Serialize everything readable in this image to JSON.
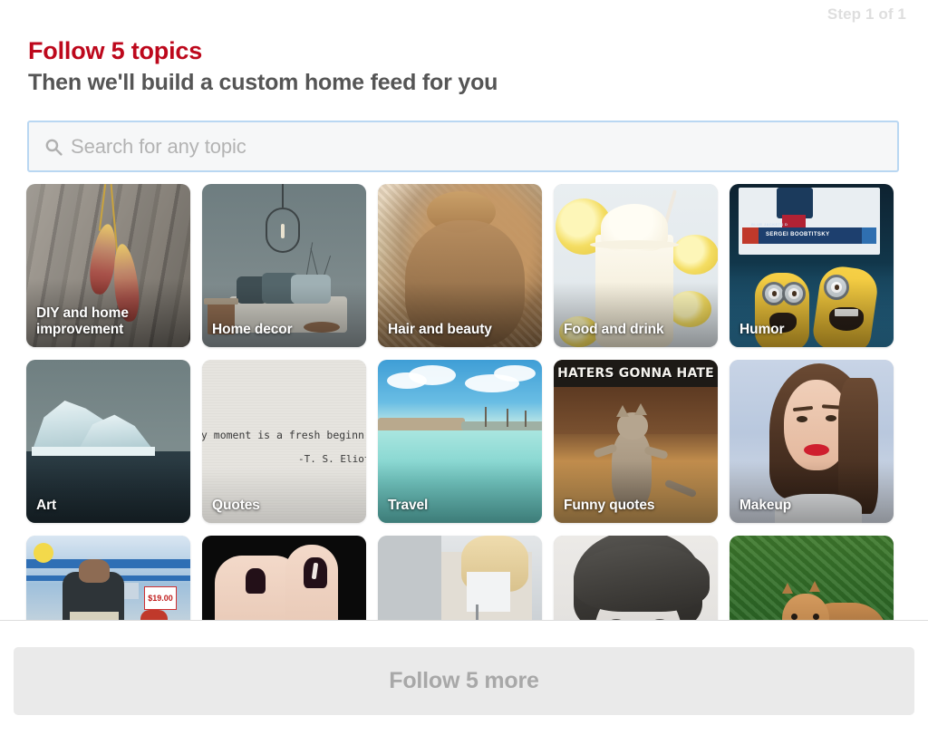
{
  "header": {
    "step_counter": "Step 1 of 1",
    "title": "Follow 5 topics",
    "subtitle": "Then we'll build a custom home feed for you",
    "title_color": "#bd081c",
    "subtitle_color": "#555555"
  },
  "search": {
    "icon": "search-icon",
    "placeholder": "Search for any topic",
    "value": "",
    "focus_border_color": "#b9d7f2"
  },
  "grid": {
    "columns": 5,
    "tiles": [
      {
        "label": "DIY and home improvement",
        "selected": false
      },
      {
        "label": "Home decor",
        "selected": false
      },
      {
        "label": "Hair and beauty",
        "selected": false
      },
      {
        "label": "Food and drink",
        "selected": false
      },
      {
        "label": "Humor",
        "selected": false
      },
      {
        "label": "Art",
        "selected": false
      },
      {
        "label": "Quotes",
        "selected": false
      },
      {
        "label": "Travel",
        "selected": false
      },
      {
        "label": "Funny quotes",
        "selected": false
      },
      {
        "label": "Makeup",
        "selected": false
      },
      {
        "label": "",
        "selected": false
      },
      {
        "label": "",
        "selected": false
      },
      {
        "label": "",
        "selected": false
      },
      {
        "label": "",
        "selected": false
      },
      {
        "label": "",
        "selected": false
      }
    ]
  },
  "artwork_text": {
    "quotes_line1": "ry moment is a fresh beginn",
    "quotes_line2": "-T. S. Eliot",
    "humor_scoreboard_player": "SERGEI BOOBTITSKY",
    "humor_scoreboard_team": "BLUE JACKETS D",
    "funny_quotes_meme": "HATERS GONNA HATE",
    "store_price": "$19.00"
  },
  "footer": {
    "follow_button_label": "Follow 5 more",
    "follow_button_enabled": false,
    "follow_button_bg": "#eaeaea",
    "follow_button_text_color": "#a8a8a8"
  }
}
